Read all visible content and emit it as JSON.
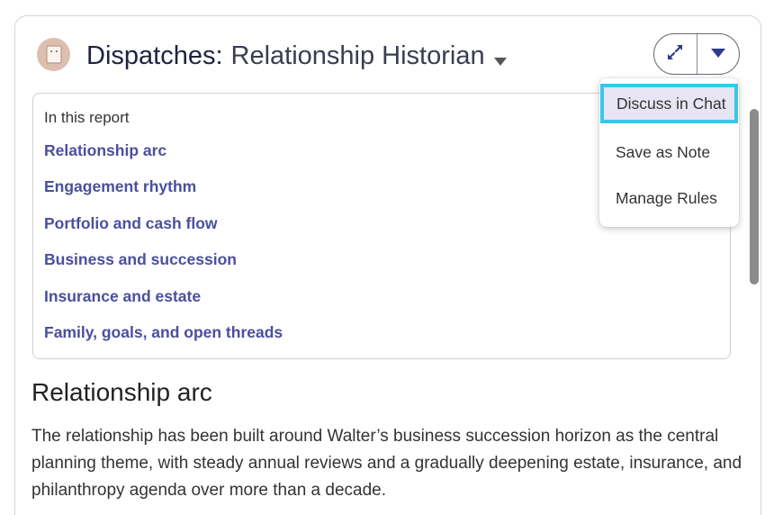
{
  "header": {
    "title_prefix": "Dispatches:",
    "title_name": "Relationship Historian",
    "icons": {
      "app": "notebook-icon",
      "title_caret": "caret-down-icon",
      "expand": "expand-icon",
      "menu": "caret-down-icon"
    }
  },
  "toc": {
    "heading": "In this report",
    "links": [
      "Relationship arc",
      "Engagement rhythm",
      "Portfolio and cash flow",
      "Business and succession",
      "Insurance and estate",
      "Family, goals, and open threads"
    ]
  },
  "content": {
    "section_title": "Relationship arc",
    "paragraph": "The relationship has been built around Walter’s business succession horizon as the central planning theme, with steady annual reviews and a gradually deepening estate, insurance, and philanthropy agenda over more than a decade."
  },
  "menu": {
    "items": [
      "Discuss in Chat",
      "Save as Note",
      "Manage Rules"
    ],
    "highlighted_index": 0
  },
  "colors": {
    "link": "#4a4f9e",
    "accent_border": "#38c7ec",
    "highlight_bg": "#e7e5f4",
    "icon_bg": "#dcbfb0"
  }
}
